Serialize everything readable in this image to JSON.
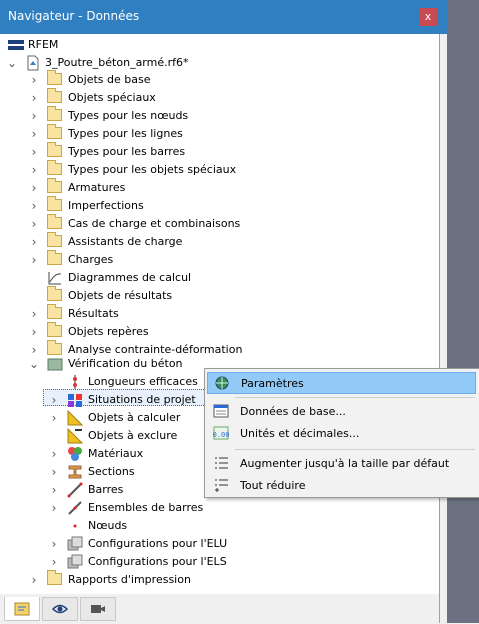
{
  "window": {
    "title": "Navigateur - Données",
    "close_glyph": "x"
  },
  "tree": {
    "root": "RFEM",
    "model": "3_Poutre_béton_armé.rf6*",
    "items": [
      "Objets de base",
      "Objets spéciaux",
      "Types pour les nœuds",
      "Types pour les lignes",
      "Types pour les barres",
      "Types pour les objets spéciaux",
      "Armatures",
      "Imperfections",
      "Cas de charge et combinaisons",
      "Assistants de charge",
      "Charges",
      "Diagrammes de calcul",
      "Objets de résultats",
      "Résultats",
      "Objets repères",
      "Analyse contrainte-déformation",
      "Vérification du béton"
    ],
    "concrete_children": [
      "Longueurs efficaces",
      "Situations de projet",
      "Objets à calculer",
      "Objets à exclure",
      "Matériaux",
      "Sections",
      "Barres",
      "Ensembles de barres",
      "Nœuds",
      "Configurations pour l'ELU",
      "Configurations pour l'ELS"
    ],
    "last": "Rapports d'impression"
  },
  "context_menu": {
    "items": [
      "Paramètres",
      "Données de base...",
      "Unités et décimales...",
      "Augmenter jusqu'à la taille par défaut",
      "Tout réduire"
    ]
  },
  "bottom_tabs": [
    "data-tab",
    "view-tab",
    "camera-tab"
  ],
  "colors": {
    "titlebar": "#2f7fc1",
    "highlight": "#91c9f7",
    "close": "#c74b50"
  }
}
